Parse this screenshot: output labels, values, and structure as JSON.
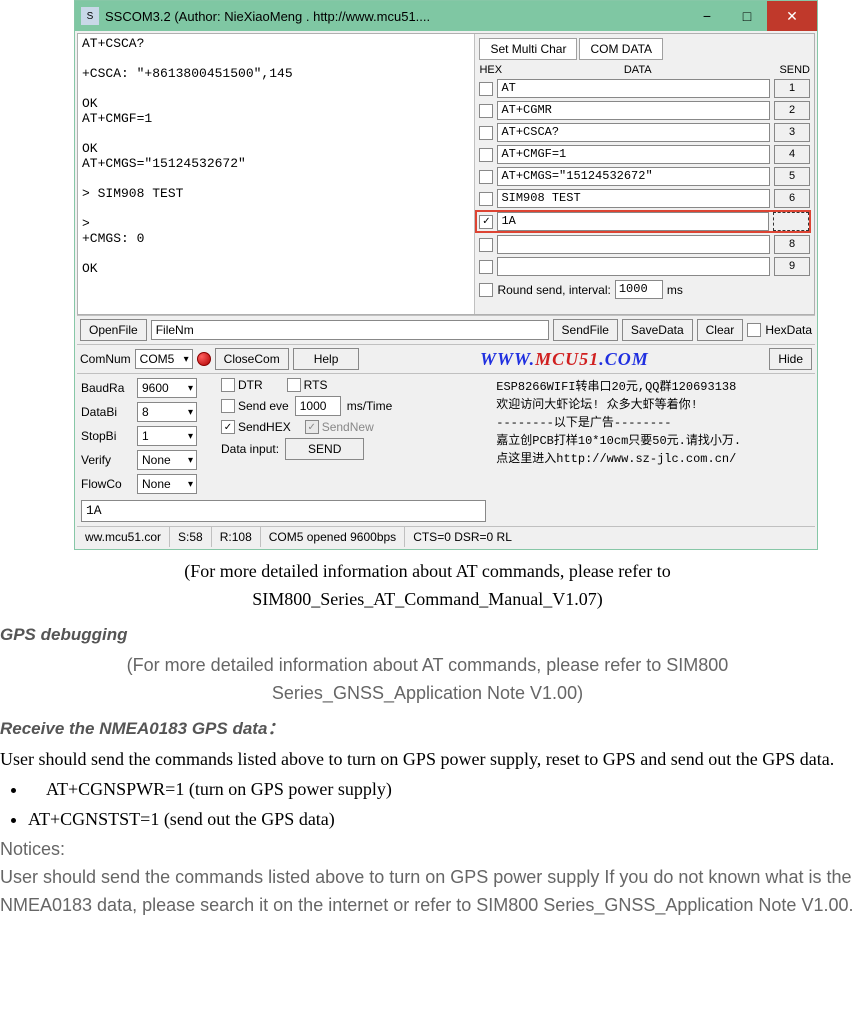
{
  "window": {
    "title": "SSCOM3.2 (Author: NieXiaoMeng .  http://www.mcu51....",
    "icon_label": "S"
  },
  "terminal_text": "AT+CSCA?\n\n+CSCA: \"+8613800451500\",145\n\nOK\nAT+CMGF=1\n\nOK\nAT+CMGS=\"15124532672\"\n\n> SIM908 TEST\n\n>\n+CMGS: 0\n\nOK",
  "tabs": {
    "set_multi": "Set Multi Char",
    "com_data": "COM DATA"
  },
  "multi_header": {
    "hex": "HEX",
    "data": "DATA",
    "send": "SEND"
  },
  "rows": [
    {
      "checked": false,
      "text": "AT",
      "btn": "1"
    },
    {
      "checked": false,
      "text": "AT+CGMR",
      "btn": "2"
    },
    {
      "checked": false,
      "text": "AT+CSCA?",
      "btn": "3"
    },
    {
      "checked": false,
      "text": "AT+CMGF=1",
      "btn": "4"
    },
    {
      "checked": false,
      "text": "AT+CMGS=\"15124532672\"",
      "btn": "5"
    },
    {
      "checked": false,
      "text": "SIM908 TEST",
      "btn": "6"
    },
    {
      "checked": true,
      "text": "1A",
      "btn": "",
      "highlight": true
    },
    {
      "checked": false,
      "text": "",
      "btn": "8"
    },
    {
      "checked": false,
      "text": "",
      "btn": "9"
    }
  ],
  "round": {
    "label": "Round send, interval:",
    "value": "1000",
    "unit": "ms"
  },
  "toolbar1": {
    "openfile": "OpenFile",
    "filenm": "FileNm",
    "sendfile": "SendFile",
    "savedata": "SaveData",
    "clear": "Clear",
    "hexdata": "HexData"
  },
  "toolbar2": {
    "comnum": "ComNum",
    "com": "COM5",
    "closecom": "CloseCom",
    "help": "Help",
    "brand1": "WWW.",
    "brand2": "MCU51",
    "brand3": ".COM",
    "hide": "Hide"
  },
  "settings": {
    "baudra": {
      "label": "BaudRa",
      "value": "9600"
    },
    "databi": {
      "label": "DataBi",
      "value": "8"
    },
    "stopbi": {
      "label": "StopBi",
      "value": "1"
    },
    "verify": {
      "label": "Verify",
      "value": "None"
    },
    "flowco": {
      "label": "FlowCo",
      "value": "None"
    },
    "dtr": "DTR",
    "rts": "RTS",
    "sendeve": "Send eve",
    "sendeve_val": "1000",
    "sendeve_unit": "ms/Time",
    "sendhex": "SendHEX",
    "sendnew": "SendNew",
    "datainput": "Data input:",
    "send_btn": "SEND",
    "datainput_val": "1A"
  },
  "right_text": "ESP8266WIFI转串口20元,QQ群120693138\n欢迎访问大虾论坛! 众多大虾等着你!\n--------以下是广告--------\n嘉立创PCB打样10*10cm只要50元.请找小万.\n点这里进入http://www.sz-jlc.com.cn/",
  "status": {
    "url": "ww.mcu51.cor",
    "s": "S:58",
    "r": "R:108",
    "conn": "COM5 opened 9600bps",
    "cts": "CTS=0 DSR=0 RL"
  },
  "doc": {
    "note1a": "(For more detailed information about AT commands, please refer to",
    "note1b": "SIM800_Series_AT_Command_Manual_V1.07)",
    "h_gps": "GPS debugging",
    "note2": "(For more detailed information about AT commands, please refer to SIM800 Series_GNSS_Application Note V1.00)",
    "h_recv": "Receive the NMEA0183 GPS data：",
    "p1": "User should send the commands listed above to turn on GPS power supply, reset to GPS and send out the GPS data.",
    "li1": "AT+CGNSPWR=1 (turn on GPS power supply)",
    "li2": "AT+CGNSTST=1 (send out the GPS data)",
    "notices": "Notices:",
    "p2": "User should send the commands listed above to turn on GPS power supply If you do not known what is the NMEA0183 data, please search it on the internet or refer to SIM800 Series_GNSS_Application Note V1.00."
  }
}
